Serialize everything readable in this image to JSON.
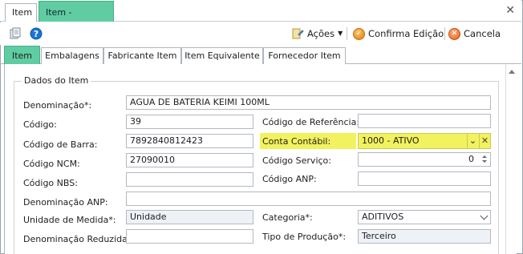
{
  "window": {
    "tabs": [
      "Item",
      "Item - [Edição]"
    ],
    "close_symbol": "✕"
  },
  "toolbar": {
    "acoes_label": "Ações",
    "confirm_label": "Confirma Edição",
    "cancel_label": "Cancela"
  },
  "tabs": [
    "Item",
    "Embalagens",
    "Fabricante Item",
    "Item Equivalente",
    "Fornecedor Item"
  ],
  "group_title": "Dados do Item",
  "labels": {
    "denominacao": "Denominação*:",
    "codigo": "Código:",
    "codigo_barra": "Código de Barra:",
    "codigo_ncm": "Código NCM:",
    "codigo_nbs": "Código NBS:",
    "denominacao_anp": "Denominação ANP:",
    "unidade_medida": "Unidade de Medida*:",
    "denominacao_reduzida": "Denominação Reduzida:",
    "codigo_referencia": "Código de Referência:",
    "conta_contabil": "Conta Contábil:",
    "codigo_servico": "Código Serviço:",
    "codigo_anp": "Código ANP:",
    "categoria": "Categoria*:",
    "tipo_producao": "Tipo de Produção*:"
  },
  "values": {
    "denominacao": "AGUA DE BATERIA KEIMI 100ML",
    "codigo": "39",
    "codigo_barra": "7892840812423",
    "codigo_ncm": "27090010",
    "codigo_nbs": "",
    "denominacao_anp": "",
    "unidade_medida": "Unidade",
    "denominacao_reduzida": "",
    "codigo_referencia": "",
    "conta_contabil": "1000 - ATIVO",
    "codigo_servico": "0",
    "codigo_anp": "",
    "categoria": "ADITIVOS",
    "tipo_producao": "Terceiro"
  },
  "colors": {
    "active_tab": "#5fcca1",
    "highlight": "#f2f25e"
  },
  "icons": [
    "print-preview-icon",
    "help-icon",
    "actions-icon",
    "confirm-icon",
    "cancel-icon"
  ]
}
